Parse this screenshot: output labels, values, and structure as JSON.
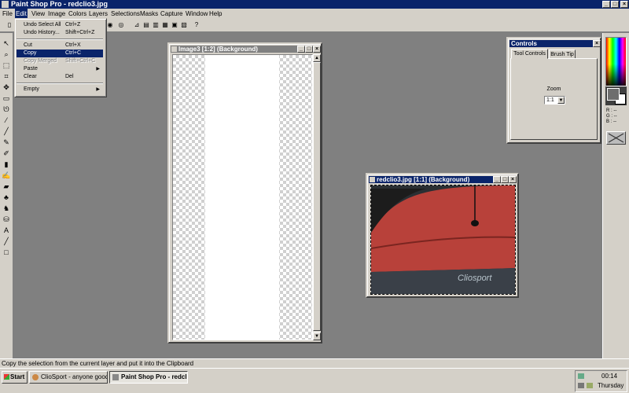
{
  "app": {
    "title": "Paint Shop Pro - redclio3.jpg",
    "caption_buttons": [
      "_",
      "□",
      "×"
    ]
  },
  "menubar": {
    "items": [
      "File",
      "Edit",
      "View",
      "Image",
      "Colors",
      "Layers",
      "Selections",
      "Masks",
      "Capture",
      "Window",
      "Help"
    ],
    "active": "Edit"
  },
  "edit_menu": {
    "items": [
      {
        "label": "Undo Select All",
        "shortcut": "Ctrl+Z"
      },
      {
        "label": "Undo History...",
        "shortcut": "Shift+Ctrl+Z"
      },
      {
        "label": "Cut",
        "shortcut": "Ctrl+X"
      },
      {
        "label": "Copy",
        "shortcut": "Ctrl+C"
      },
      {
        "label": "Copy Merged",
        "shortcut": "Shift+Ctrl+C"
      },
      {
        "label": "Paste",
        "shortcut": ""
      },
      {
        "label": "Clear",
        "shortcut": "Del"
      },
      {
        "label": "Empty",
        "shortcut": ""
      }
    ],
    "selected": "Copy",
    "disabled": [
      "Copy Merged"
    ],
    "submenus": [
      "Paste",
      "Empty"
    ]
  },
  "document_windows": [
    {
      "title": "Image3 [1:2] (Background)",
      "active": false
    },
    {
      "title": "redclio3.jpg [1:1] (Background)",
      "active": true,
      "watermark": "Cliosport"
    }
  ],
  "controls_panel": {
    "title": "Controls",
    "tabs": [
      "Tool Controls",
      "Brush Tip"
    ],
    "active_tab": "Tool Controls",
    "zoom_label": "Zoom",
    "zoom_value": "1:1"
  },
  "color_readout": {
    "r": "R : --",
    "g": "G : --",
    "b": "B : --"
  },
  "status_bar": {
    "text": "Copy the selection from the current layer and put it into the Clipboard"
  },
  "taskbar": {
    "start_label": "Start",
    "tasks": [
      {
        "label": "ClioSport - anyone good ...",
        "pressed": false
      },
      {
        "label": "Paint Shop Pro - redcl...",
        "pressed": true
      }
    ],
    "clock_time": "00:14",
    "clock_day": "Thursday"
  },
  "colors": {
    "titlebar": "#0a246a",
    "desktop": "#808080",
    "chrome": "#d4d0c8",
    "car_red": "#b8413a",
    "foreground_swatch": "#6e6e6e"
  }
}
